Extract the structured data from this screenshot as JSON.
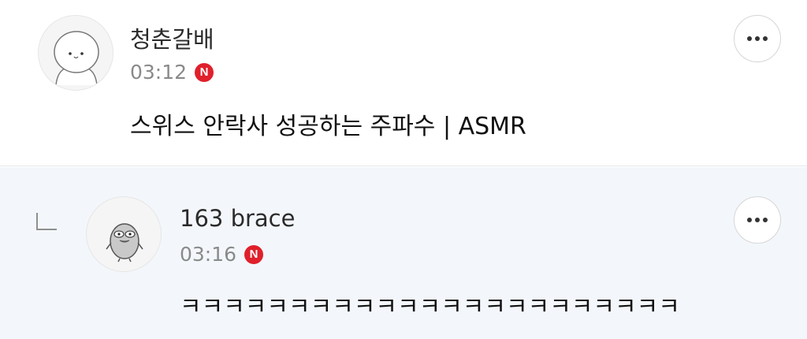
{
  "comments": [
    {
      "author": "청춘갈배",
      "time": "03:12",
      "badge": "N",
      "text": "스위스 안락사 성공하는 주파수 | ASMR",
      "avatar_icon": "bear-avatar-icon",
      "more_icon": "more-options-icon"
    },
    {
      "author": "163 brace",
      "time": "03:16",
      "badge": "N",
      "text": "ㅋㅋㅋㅋㅋㅋㅋㅋㅋㅋㅋㅋㅋㅋㅋㅋㅋㅋㅋㅋㅋㅋㅋ",
      "avatar_icon": "duck-avatar-icon",
      "reply_icon": "reply-arrow-icon",
      "more_icon": "more-options-icon"
    }
  ],
  "colors": {
    "badge_red": "#e0202b",
    "reply_background": "#f3f7fb",
    "time_gray": "#8a8a8a"
  }
}
